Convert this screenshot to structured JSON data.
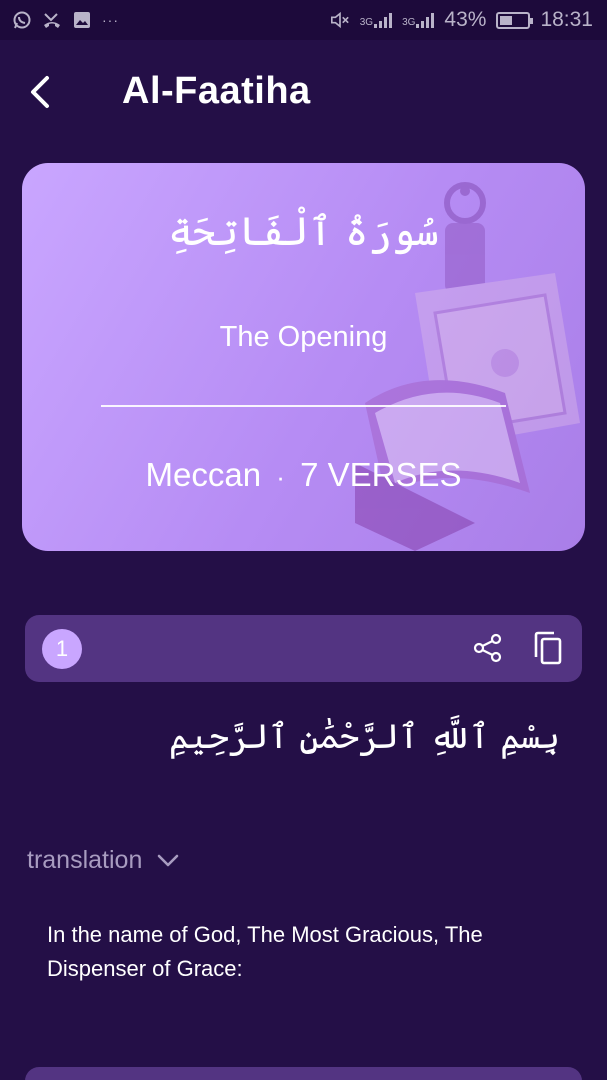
{
  "status_bar": {
    "battery_text": "43%",
    "battery_level": 0.43,
    "time": "18:31",
    "network_1": "3G",
    "network_2": "3G",
    "dots": "···"
  },
  "header": {
    "title": "Al-Faatiha"
  },
  "surah_card": {
    "arabic_name": "سُورَةُ ٱلْفَاتِحَةِ",
    "translation": "The Opening",
    "revelation_type": "Meccan",
    "separator": "·",
    "verses_label": "7 VERSES"
  },
  "verses": [
    {
      "number": "1",
      "arabic": "بِسْمِ ٱللَّهِ ٱلرَّحْمَٰنِ ٱلرَّحِيمِ",
      "translation": "In the name of God, The Most Gracious, The Dispenser of Grace:"
    }
  ],
  "translation_toggle": {
    "label": "translation"
  },
  "colors": {
    "background": "#240f47",
    "card": "#b68cf4",
    "verse_bar": "#533482",
    "accent": "#c9a6ff"
  }
}
